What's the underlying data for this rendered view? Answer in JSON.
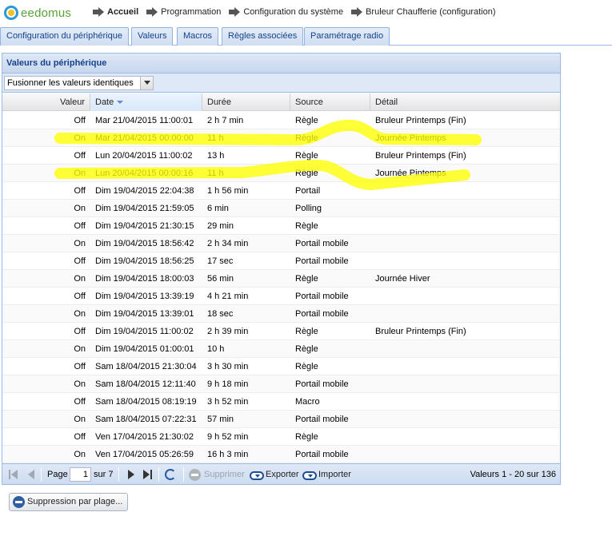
{
  "logo": {
    "text": "eedomus"
  },
  "breadcrumb": [
    "Accueil",
    "Programmation",
    "Configuration du système",
    "Bruleur Chaufferie (configuration)"
  ],
  "tabs": [
    "Configuration du périphérique",
    "Valeurs",
    "Macros",
    "Règles associées",
    "Paramétrage radio"
  ],
  "panel": {
    "title": "Valeurs du périphérique",
    "merge_select": "Fusionner les valeurs identiques"
  },
  "grid": {
    "columns": [
      "Valeur",
      "Date",
      "Durée",
      "Source",
      "Détail"
    ],
    "rows": [
      [
        "Off",
        "Mar 21/04/2015 11:00:01",
        "2 h 7 min",
        "Règle",
        "Bruleur Printemps (Fin)"
      ],
      [
        "On",
        "Mar 21/04/2015 00:00:00",
        "11 h",
        "Règle",
        "Journée Pintemps"
      ],
      [
        "Off",
        "Lun 20/04/2015 11:00:02",
        "13 h",
        "Règle",
        "Bruleur Printemps (Fin)"
      ],
      [
        "On",
        "Lun 20/04/2015 00:00:16",
        "11 h",
        "Règle",
        "Journée Pintemps"
      ],
      [
        "Off",
        "Dim 19/04/2015 22:04:38",
        "1 h 56 min",
        "Portail",
        ""
      ],
      [
        "On",
        "Dim 19/04/2015 21:59:05",
        "6 min",
        "Polling",
        ""
      ],
      [
        "Off",
        "Dim 19/04/2015 21:30:15",
        "29 min",
        "Règle",
        ""
      ],
      [
        "On",
        "Dim 19/04/2015 18:56:42",
        "2 h 34 min",
        "Portail mobile",
        ""
      ],
      [
        "Off",
        "Dim 19/04/2015 18:56:25",
        "17 sec",
        "Portail mobile",
        ""
      ],
      [
        "On",
        "Dim 19/04/2015 18:00:03",
        "56 min",
        "Règle",
        "Journée Hiver"
      ],
      [
        "Off",
        "Dim 19/04/2015 13:39:19",
        "4 h 21 min",
        "Portail mobile",
        ""
      ],
      [
        "On",
        "Dim 19/04/2015 13:39:01",
        "18 sec",
        "Portail mobile",
        ""
      ],
      [
        "Off",
        "Dim 19/04/2015 11:00:02",
        "2 h 39 min",
        "Règle",
        "Bruleur Printemps (Fin)"
      ],
      [
        "On",
        "Dim 19/04/2015 01:00:01",
        "10 h",
        "Règle",
        ""
      ],
      [
        "Off",
        "Sam 18/04/2015 21:30:04",
        "3 h 30 min",
        "Règle",
        ""
      ],
      [
        "On",
        "Sam 18/04/2015 12:11:40",
        "9 h 18 min",
        "Portail mobile",
        ""
      ],
      [
        "Off",
        "Sam 18/04/2015 08:19:19",
        "3 h 52 min",
        "Macro",
        ""
      ],
      [
        "On",
        "Sam 18/04/2015 07:22:31",
        "57 min",
        "Portail mobile",
        ""
      ],
      [
        "Off",
        "Ven 17/04/2015 21:30:02",
        "9 h 52 min",
        "Règle",
        ""
      ],
      [
        "On",
        "Ven 17/04/2015 05:26:59",
        "16 h 3 min",
        "Portail mobile",
        ""
      ]
    ]
  },
  "paging": {
    "page_label": "Page",
    "current_page": "1",
    "of_label": "sur 7",
    "delete_label": "Supprimer",
    "export_label": "Exporter",
    "import_label": "Importer",
    "summary": "Valeurs 1 - 20 sur 136"
  },
  "bottom_button": {
    "label": "Suppression par plage..."
  },
  "colors": {
    "highlighter": "#ffff00",
    "header_blue": "#15428b",
    "border_blue": "#99bbe8"
  }
}
